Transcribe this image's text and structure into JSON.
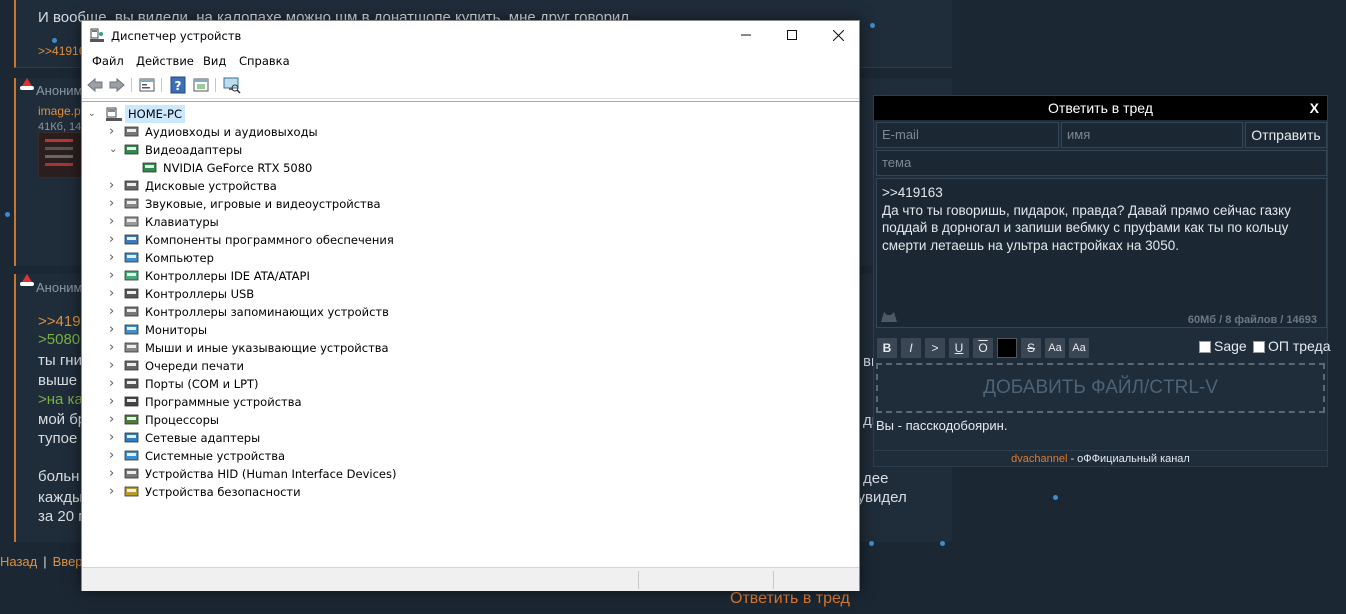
{
  "background": {
    "post_top_text": "И вообще, вы видели, на калопахе можно шм в донатшопе купить, мне друг говорил",
    "post_top_link": ">>41916",
    "post_mid_author": "Аноним 2",
    "post_mid_file": "image.p",
    "post_mid_size": "41Кб, 14",
    "post_bot_author": "Аноним 2",
    "post_bot_lines": [
      {
        "kind": "quote",
        "text": ">>419"
      },
      {
        "kind": "green",
        "text": ">5080"
      },
      {
        "kind": "text",
        "text": "ты гни"
      },
      {
        "kind": "text",
        "text": "выше"
      },
      {
        "kind": "green",
        "text": ">на ка"
      },
      {
        "kind": "text",
        "text": "мой бр"
      },
      {
        "kind": "text",
        "text": "тупое"
      },
      {
        "kind": "text",
        "text": "больн"
      },
      {
        "kind": "text",
        "text": "кажды"
      },
      {
        "kind": "text",
        "text": "за 20 м"
      }
    ],
    "post_bot_right_fragments": [
      "ви",
      "ди",
      "дее",
      "а увидел"
    ],
    "nav_back": "Назад",
    "nav_up": "Вверх",
    "reply_bottom": "Ответить в тред"
  },
  "window": {
    "title": "Диспетчер устройств",
    "menu": [
      "Файл",
      "Действие",
      "Вид",
      "Справка"
    ],
    "root": "HOME-PC",
    "categories": [
      {
        "label": "Аудиовходы и аудиовыходы",
        "icon": "speaker-icon",
        "expanded": false
      },
      {
        "label": "Видеоадаптеры",
        "icon": "display-adapter-icon",
        "expanded": true,
        "children": [
          {
            "label": "NVIDIA GeForce RTX 5080",
            "icon": "display-adapter-icon"
          }
        ]
      },
      {
        "label": "Дисковые устройства",
        "icon": "disk-drive-icon",
        "expanded": false
      },
      {
        "label": "Звуковые, игровые и видеоустройства",
        "icon": "sound-device-icon",
        "expanded": false
      },
      {
        "label": "Клавиатуры",
        "icon": "keyboard-icon",
        "expanded": false
      },
      {
        "label": "Компоненты программного обеспечения",
        "icon": "software-component-icon",
        "expanded": false
      },
      {
        "label": "Компьютер",
        "icon": "computer-icon",
        "expanded": false
      },
      {
        "label": "Контроллеры IDE ATA/ATAPI",
        "icon": "ide-controller-icon",
        "expanded": false
      },
      {
        "label": "Контроллеры USB",
        "icon": "usb-icon",
        "expanded": false
      },
      {
        "label": "Контроллеры запоминающих устройств",
        "icon": "storage-controller-icon",
        "expanded": false
      },
      {
        "label": "Мониторы",
        "icon": "monitor-icon",
        "expanded": false
      },
      {
        "label": "Мыши и иные указывающие устройства",
        "icon": "mouse-icon",
        "expanded": false
      },
      {
        "label": "Очереди печати",
        "icon": "printer-icon",
        "expanded": false
      },
      {
        "label": "Порты (COM и LPT)",
        "icon": "port-icon",
        "expanded": false
      },
      {
        "label": "Программные устройства",
        "icon": "software-device-icon",
        "expanded": false
      },
      {
        "label": "Процессоры",
        "icon": "processor-icon",
        "expanded": false
      },
      {
        "label": "Сетевые адаптеры",
        "icon": "network-adapter-icon",
        "expanded": false
      },
      {
        "label": "Системные устройства",
        "icon": "system-device-icon",
        "expanded": false
      },
      {
        "label": "Устройства HID (Human Interface Devices)",
        "icon": "hid-icon",
        "expanded": false
      },
      {
        "label": "Устройства безопасности",
        "icon": "security-device-icon",
        "expanded": false
      }
    ]
  },
  "reply_form": {
    "title": "Ответить в тред",
    "close": "X",
    "email_placeholder": "E-mail",
    "name_placeholder": "имя",
    "send": "Отправить",
    "subject_placeholder": "тема",
    "message_lines": [
      ">>419163",
      "Да что ты говоришь, пидарок, правда? Давай прямо сейчас газку",
      "поддай в дорногал и запиши вебмку с пруфами как ты по кольцу",
      "смерти летаешь на ультра настройках на 3050."
    ],
    "counter": "60Мб / 8 файлов / 14693",
    "format_buttons": [
      "B",
      "I",
      ">",
      "U",
      "O",
      "█",
      "S",
      "Aa",
      "Aa"
    ],
    "sage_label": "Sage",
    "op_label": "ОП треда",
    "dropzone": "ДОБАВИТЬ ФАЙЛ/CTRL-V",
    "slogan": "Вы - пасскодобоярин.",
    "channel_link": "dvachannel",
    "channel_text": " - оФФициальный канал"
  },
  "colors": {
    "accent": "#e07a2f",
    "selection": "#cce8ff",
    "board_bg": "#1b2733"
  }
}
